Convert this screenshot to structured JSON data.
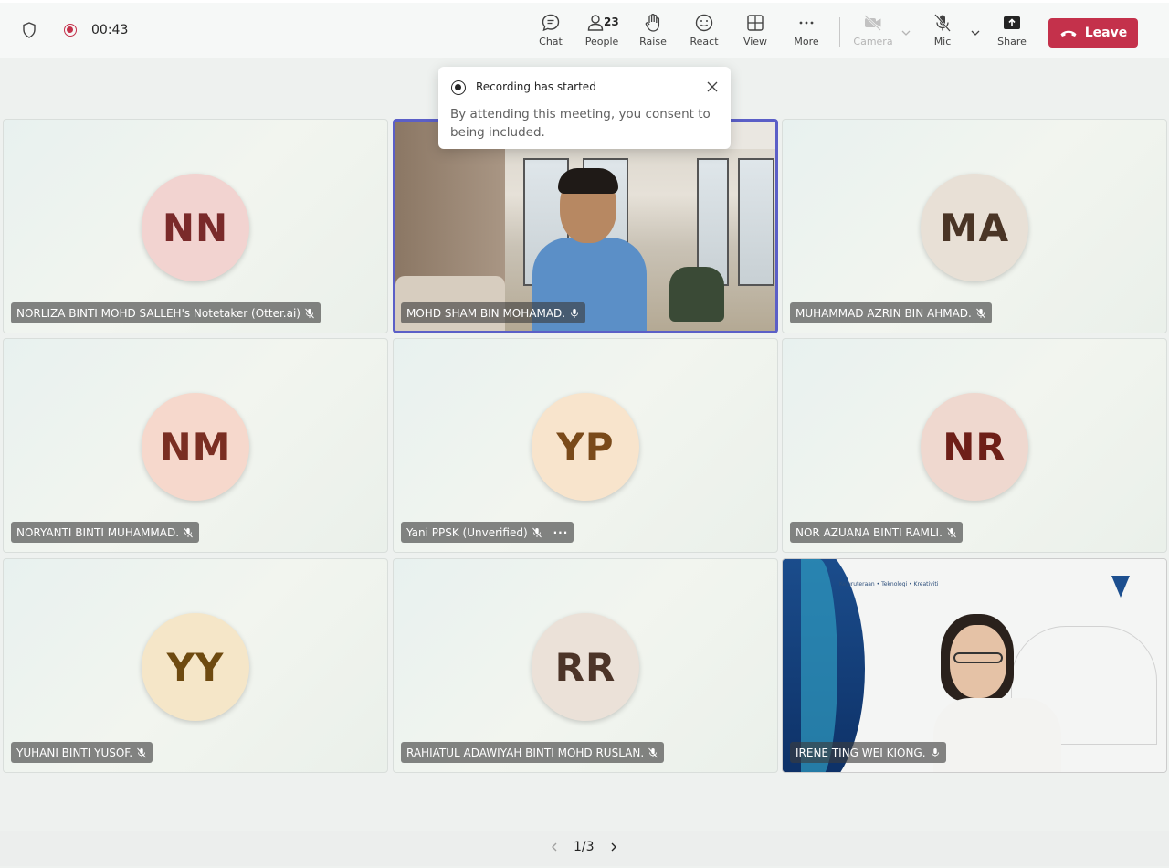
{
  "call": {
    "timer": "00:43"
  },
  "toolbar": {
    "chat": "Chat",
    "people": "People",
    "people_count": "23",
    "raise": "Raise",
    "react": "React",
    "view": "View",
    "more": "More",
    "camera": "Camera",
    "mic": "Mic",
    "share": "Share",
    "leave": "Leave"
  },
  "toast": {
    "title": "Recording has started",
    "body": "By attending this meeting, you consent to being included."
  },
  "participants": [
    {
      "initials": "NN",
      "name": "NORLIZA BINTI MOHD SALLEH's Notetaker (Otter.ai)",
      "mic": "muted",
      "avatar_bg": "#f2d3d0",
      "avatar_fg": "#7a2a2a"
    },
    {
      "initials": "",
      "name": "MOHD SHAM BIN MOHAMAD.",
      "mic": "on",
      "video": true
    },
    {
      "initials": "MA",
      "name": "MUHAMMAD AZRIN BIN AHMAD.",
      "mic": "muted",
      "avatar_bg": "#e8e0d6",
      "avatar_fg": "#4a3526"
    },
    {
      "initials": "NM",
      "name": "NORYANTI BINTI MUHAMMAD.",
      "mic": "muted",
      "avatar_bg": "#f6d8cc",
      "avatar_fg": "#7a2e22"
    },
    {
      "initials": "YP",
      "name": "Yani PPSK (Unverified)",
      "mic": "muted",
      "more": "···",
      "avatar_bg": "#f8e4cc",
      "avatar_fg": "#7a4a1a"
    },
    {
      "initials": "NR",
      "name": "NOR AZUANA BINTI RAMLI.",
      "mic": "muted",
      "avatar_bg": "#efd8cf",
      "avatar_fg": "#6e1f18"
    },
    {
      "initials": "YY",
      "name": "YUHANI BINTI YUSOF.",
      "mic": "muted",
      "avatar_bg": "#f5e6c8",
      "avatar_fg": "#6e4a10"
    },
    {
      "initials": "RR",
      "name": "RAHIATUL ADAWIYAH BINTI MOHD RUSLAN.",
      "mic": "muted",
      "avatar_bg": "#ebe1d8",
      "avatar_fg": "#4c3428"
    },
    {
      "initials": "",
      "name": "IRENE TING WEI KIONG.",
      "mic": "on",
      "video": true,
      "slide_tagline": "Kejuruteraan • Teknologi • Kreativiti"
    }
  ],
  "pager": {
    "label": "1/3"
  },
  "colors": {
    "leave": "#c4314b",
    "active_speaker": "#5b5fc7",
    "recording": "#c4314b"
  }
}
